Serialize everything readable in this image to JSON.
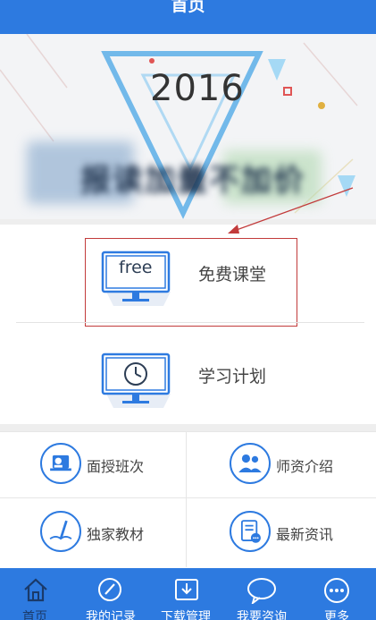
{
  "header": {
    "title": "首页"
  },
  "banner": {
    "year": "2016",
    "slogan": "报读加量不加价"
  },
  "courses": [
    {
      "label": "免费课堂",
      "monitor_text": "free",
      "icon": "free-monitor-icon"
    },
    {
      "label": "学习计划",
      "icon": "clock-monitor-icon"
    }
  ],
  "grid": [
    {
      "label": "面授班次",
      "icon": "teacher-screen-icon"
    },
    {
      "label": "师资介绍",
      "icon": "people-icon"
    },
    {
      "label": "独家教材",
      "icon": "book-pen-icon"
    },
    {
      "label": "最新资讯",
      "icon": "news-document-icon"
    }
  ],
  "tabs": [
    {
      "label": "首页",
      "icon": "home-icon"
    },
    {
      "label": "我的记录",
      "icon": "pen-circle-icon"
    },
    {
      "label": "下载管理",
      "icon": "download-icon"
    },
    {
      "label": "我要咨询",
      "icon": "chat-bubble-icon"
    },
    {
      "label": "更多",
      "icon": "more-dots-icon"
    }
  ],
  "colors": {
    "brand_blue": "#2d7ae0",
    "highlight_red": "#c23b3b"
  }
}
